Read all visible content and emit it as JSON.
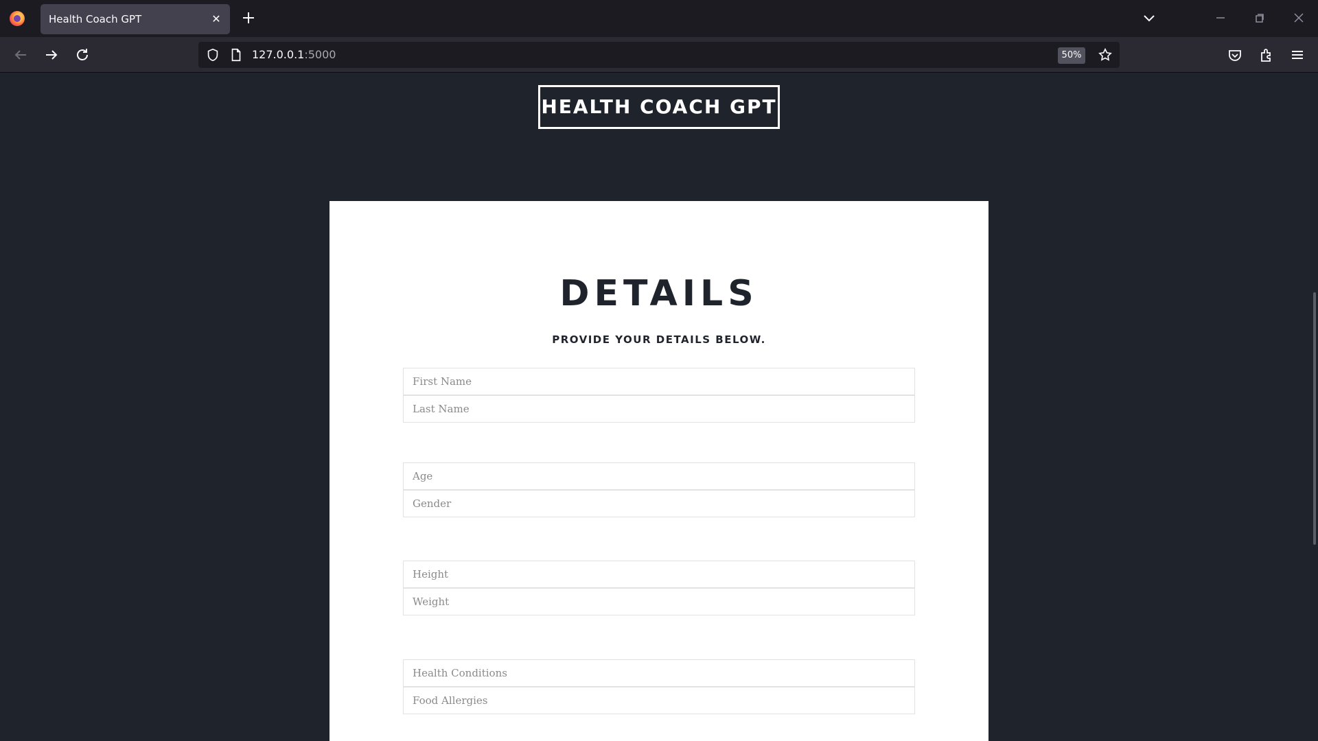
{
  "browser": {
    "tab_title": "Health Coach GPT",
    "url_host": "127.0.0.1",
    "url_port": ":5000",
    "zoom": "50%"
  },
  "header": {
    "logo": "HEALTH COACH GPT"
  },
  "form": {
    "title": "DETAILS",
    "subtitle": "PROVIDE YOUR DETAILS BELOW.",
    "fields": {
      "first_name": "First Name",
      "last_name": "Last Name",
      "age": "Age",
      "gender": "Gender",
      "height": "Height",
      "weight": "Weight",
      "health_conditions": "Health Conditions",
      "food_allergies": "Food Allergies"
    }
  },
  "icons": [
    "firefox-icon",
    "close-icon",
    "plus-icon",
    "chevron-down-icon",
    "minimize-icon",
    "restore-icon",
    "back-icon",
    "forward-icon",
    "reload-icon",
    "shield-icon",
    "page-icon",
    "star-icon",
    "pocket-icon",
    "extensions-icon",
    "menu-icon"
  ]
}
